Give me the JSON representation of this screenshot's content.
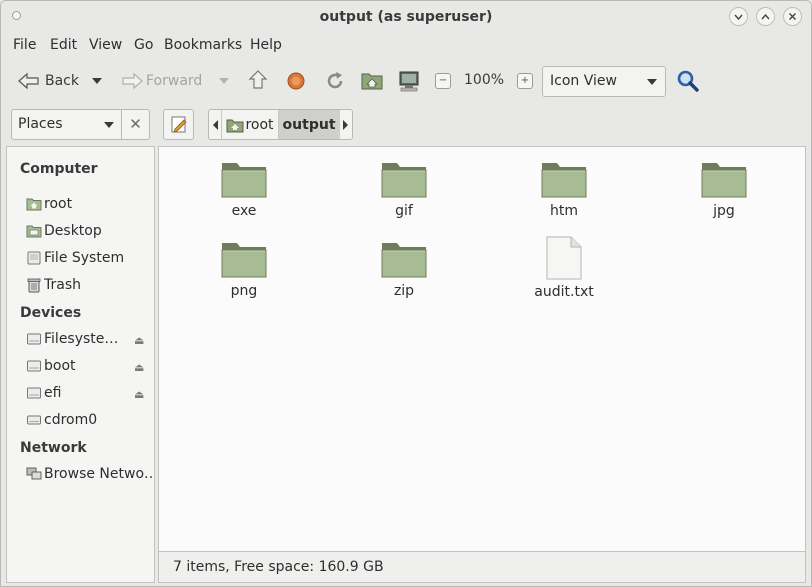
{
  "window": {
    "title": "output (as superuser)",
    "controls": [
      "minimize",
      "maximize",
      "close"
    ]
  },
  "menu": [
    "File",
    "Edit",
    "View",
    "Go",
    "Bookmarks",
    "Help"
  ],
  "toolbar": {
    "back_label": "Back",
    "forward_label": "Forward",
    "zoom_level": "100%",
    "view_mode": "Icon View"
  },
  "location": {
    "pane_selector": "Places",
    "breadcrumbs": [
      "root",
      "output"
    ],
    "current": "output"
  },
  "sidebar": {
    "sections": [
      {
        "title": "Computer",
        "items": [
          {
            "label": "root",
            "icon": "home-folder-icon"
          },
          {
            "label": "Desktop",
            "icon": "desktop-folder-icon"
          },
          {
            "label": "File System",
            "icon": "filesystem-icon"
          },
          {
            "label": "Trash",
            "icon": "trash-icon"
          }
        ]
      },
      {
        "title": "Devices",
        "items": [
          {
            "label": "Filesyste…",
            "icon": "drive-icon",
            "eject": true
          },
          {
            "label": "boot",
            "icon": "drive-icon",
            "eject": true
          },
          {
            "label": "efi",
            "icon": "drive-icon",
            "eject": true
          },
          {
            "label": "cdrom0",
            "icon": "optical-drive-icon",
            "eject": false
          }
        ]
      },
      {
        "title": "Network",
        "items": [
          {
            "label": "Browse Netwo…",
            "icon": "network-icon"
          }
        ]
      }
    ]
  },
  "files": [
    {
      "name": "exe",
      "type": "folder"
    },
    {
      "name": "gif",
      "type": "folder"
    },
    {
      "name": "htm",
      "type": "folder"
    },
    {
      "name": "jpg",
      "type": "folder"
    },
    {
      "name": "png",
      "type": "folder"
    },
    {
      "name": "zip",
      "type": "folder"
    },
    {
      "name": "audit.txt",
      "type": "text-file"
    }
  ],
  "status": "7 items, Free space: 160.9 GB",
  "colors": {
    "folder": "#a8bc93",
    "folder_dark": "#6f7d5e",
    "accent_search": "#2b5fa6",
    "stop_orange": "#d9773a"
  }
}
